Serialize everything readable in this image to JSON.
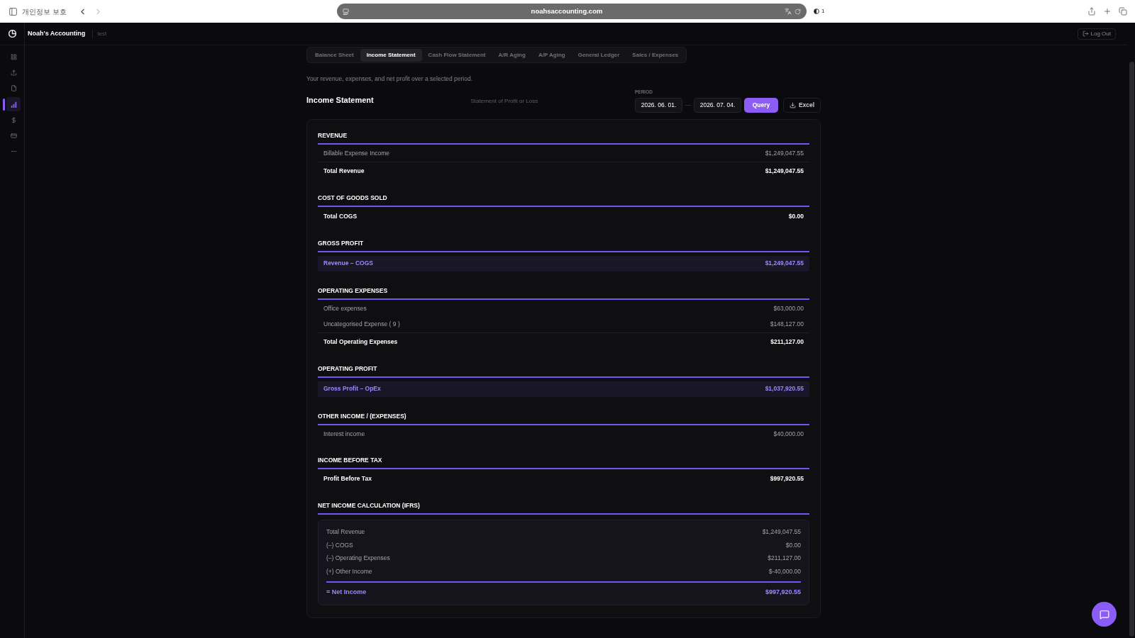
{
  "browser": {
    "privacy_label": "개인정보 보호",
    "url": "noahsaccounting.com",
    "extension_count": "1"
  },
  "app": {
    "title": "Noah's Accounting",
    "workspace": "test",
    "logout": "Log Out"
  },
  "sidebar": {
    "items": [
      {
        "selected": false
      },
      {
        "selected": false
      },
      {
        "selected": false
      },
      {
        "selected": true
      },
      {
        "selected": false
      },
      {
        "selected": false
      },
      {
        "selected": false
      }
    ]
  },
  "tabs": [
    {
      "label": "Balance Sheet",
      "selected": false
    },
    {
      "label": "Income Statement",
      "selected": true
    },
    {
      "label": "Cash Flow Statement",
      "selected": false
    },
    {
      "label": "A/R Aging",
      "selected": false
    },
    {
      "label": "A/P Aging",
      "selected": false
    },
    {
      "label": "General Ledger",
      "selected": false
    },
    {
      "label": "Sales / Expenses",
      "selected": false
    }
  ],
  "description": "Your revenue, expenses, and net profit over a selected period.",
  "header": {
    "title": "Income Statement",
    "subtitle": "Statement of Profit or Loss"
  },
  "period": {
    "label": "PERIOD",
    "start": "2026. 06. 01.",
    "separator": "—",
    "end": "2026. 07. 04.",
    "query": "Query",
    "excel": "Excel"
  },
  "sections": [
    {
      "title": "REVENUE",
      "rows": [
        {
          "kind": "line",
          "label": "Billable Expense Income",
          "amount": "$1,249,047.55"
        },
        {
          "kind": "total",
          "label": "Total Revenue",
          "amount": "$1,249,047.55"
        }
      ]
    },
    {
      "title": "COST OF GOODS SOLD",
      "rows": [
        {
          "kind": "total",
          "label": "Total COGS",
          "amount": "$0.00"
        }
      ]
    },
    {
      "title": "GROSS PROFIT",
      "rows": [
        {
          "kind": "highlight",
          "label": "Revenue – COGS",
          "amount": "$1,249,047.55"
        }
      ]
    },
    {
      "title": "OPERATING EXPENSES",
      "rows": [
        {
          "kind": "line",
          "label": "Office expenses",
          "amount": "$63,000.00"
        },
        {
          "kind": "line",
          "label": "Uncategorised Expense ( 9 )",
          "amount": "$148,127.00"
        },
        {
          "kind": "total",
          "label": "Total Operating Expenses",
          "amount": "$211,127.00"
        }
      ]
    },
    {
      "title": "OPERATING PROFIT",
      "rows": [
        {
          "kind": "highlight",
          "label": "Gross Profit – OpEx",
          "amount": "$1,037,920.55"
        }
      ]
    },
    {
      "title": "OTHER INCOME / (EXPENSES)",
      "rows": [
        {
          "kind": "line",
          "label": "Interest income",
          "amount": "$40,000.00"
        }
      ]
    },
    {
      "title": "INCOME BEFORE TAX",
      "rows": [
        {
          "kind": "total",
          "label": "Profit Before Tax",
          "amount": "$997,920.55"
        }
      ]
    }
  ],
  "net_income_calculation": {
    "title": "NET INCOME CALCULATION (IFRS)",
    "rows": [
      {
        "kind": "line",
        "label": "Total Revenue",
        "amount": "$1,249,047.55"
      },
      {
        "kind": "line",
        "label": "(–) COGS",
        "amount": "$0.00"
      },
      {
        "kind": "line",
        "label": "(–) Operating Expenses",
        "amount": "$211,127.00"
      },
      {
        "kind": "line",
        "label": "(+) Other Income",
        "amount": "$-40,000.00"
      },
      {
        "kind": "result",
        "label": "= Net Income",
        "amount": "$997,920.55"
      }
    ]
  }
}
